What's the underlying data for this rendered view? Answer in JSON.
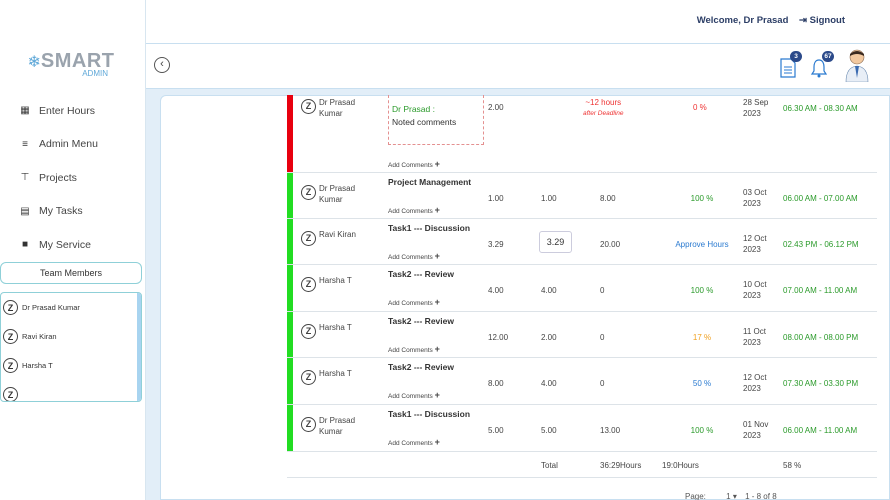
{
  "header": {
    "welcome": "Welcome, Dr Prasad",
    "signout": "Signout",
    "notifications": [
      {
        "icon": "document-icon",
        "count": "3"
      },
      {
        "icon": "bell-icon",
        "count": "67"
      }
    ]
  },
  "logo": {
    "main": "SMART",
    "sub": "ADMIN"
  },
  "sidebar": {
    "items": [
      {
        "label": "Enter Hours",
        "icon": "calendar-icon"
      },
      {
        "label": "Admin Menu",
        "icon": "menu-icon"
      },
      {
        "label": "Projects",
        "icon": "cart-icon"
      },
      {
        "label": "My Tasks",
        "icon": "tasks-icon"
      },
      {
        "label": "My Service",
        "icon": "briefcase-icon"
      }
    ],
    "team_title": "Team Members",
    "members": [
      "Dr Prasad Kumar",
      "Ravi Kiran",
      "Harsha T"
    ]
  },
  "table": {
    "add_comments": "Add Comments",
    "rows": [
      {
        "bar": "#e8000f",
        "employee": "Dr Prasad Kumar",
        "task": "",
        "comment_author": "Dr Prasad :",
        "comment_text": "Noted comments",
        "hours": "2.00",
        "alloc": "",
        "spent": "",
        "remaining": "~12 hours",
        "remaining_note": "after Deadline",
        "status": "0 %",
        "status_color": "red",
        "date": "28 Sep 2023",
        "time": "06.30 AM - 08.30 AM",
        "time_color": "green"
      },
      {
        "bar": "#22dd22",
        "employee": "Dr Prasad Kumar",
        "task": "Project Management",
        "hours": "1.00",
        "alloc": "1.00",
        "spent": "8.00",
        "status": "100 %",
        "status_color": "green",
        "date": "03 Oct 2023",
        "time": "06.00 AM - 07.00 AM",
        "time_color": "green"
      },
      {
        "bar": "#22dd22",
        "employee": "Ravi Kiran",
        "task": "Task1 --- Discussion",
        "hours": "3.29",
        "alloc_input": "3.29",
        "spent": "20.00",
        "status": "Approve Hours",
        "status_color": "blue",
        "date": "12 Oct 2023",
        "time": "02.43 PM - 06.12 PM",
        "time_color": "green"
      },
      {
        "bar": "#22dd22",
        "employee": "Harsha T",
        "task": "Task2 --- Review",
        "hours": "4.00",
        "alloc": "4.00",
        "spent": "0",
        "status": "100 %",
        "status_color": "green",
        "date": "10 Oct 2023",
        "time": "07.00 AM - 11.00 AM",
        "time_color": "green"
      },
      {
        "bar": "#22dd22",
        "employee": "Harsha T",
        "task": "Task2 --- Review",
        "hours": "12.00",
        "alloc": "2.00",
        "spent": "0",
        "status": "17 %",
        "status_color": "orange",
        "date": "11 Oct 2023",
        "time": "08.00 AM - 08.00 PM",
        "time_color": "green"
      },
      {
        "bar": "#22dd22",
        "employee": "Harsha T",
        "task": "Task2 --- Review",
        "hours": "8.00",
        "alloc": "4.00",
        "spent": "0",
        "status": "50 %",
        "status_color": "blue",
        "date": "12 Oct 2023",
        "time": "07.30 AM - 03.30 PM",
        "time_color": "green"
      },
      {
        "bar": "#22dd22",
        "employee": "Dr Prasad Kumar",
        "task": "Task1 --- Discussion",
        "hours": "5.00",
        "alloc": "5.00",
        "spent": "13.00",
        "status": "100 %",
        "status_color": "green",
        "date": "01 Nov 2023",
        "time": "06.00 AM - 11.00 AM",
        "time_color": "green"
      }
    ],
    "footer": {
      "label": "Total",
      "spent": "36:29Hours",
      "hours": "19:0Hours",
      "percent": "58 %"
    },
    "pager": {
      "label": "Page:",
      "current": "1",
      "range": "1 - 8 of 8"
    }
  }
}
